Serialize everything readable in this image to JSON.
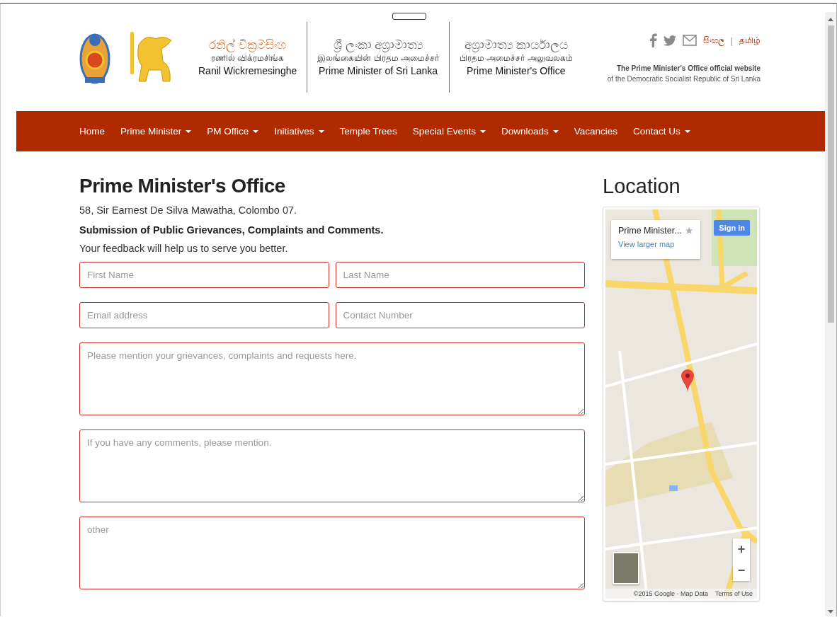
{
  "header": {
    "brands": [
      {
        "lines": [
          "රනිල් වික්‍රමසිංහ",
          "ரணில் விக்ரமசிங்க",
          "Ranil Wickremesinghe"
        ]
      },
      {
        "lines": [
          "ශ්‍රී ලංකා අග්‍රාමාත්‍ය",
          "இலங்கையின் பிரதம அமைச்சர்",
          "Prime Minister of Sri Lanka"
        ]
      },
      {
        "lines": [
          "අග්‍රාමාත්‍ය කාර්යාලය",
          "பிரதம அமைச்சர் அலுவலகம்",
          "Prime Minister's Office"
        ]
      }
    ],
    "languages": [
      "සිංහල",
      "தமிழ்"
    ],
    "language_separator": "|",
    "tagline": "The Prime Minister's Office official website",
    "subtagline": "of the Democratic Socialist Republic of Sri Lanka"
  },
  "nav": {
    "items": [
      {
        "label": "Home",
        "has_menu": false
      },
      {
        "label": "Prime Minister",
        "has_menu": true
      },
      {
        "label": "PM Office",
        "has_menu": true
      },
      {
        "label": "Initiatives",
        "has_menu": true
      },
      {
        "label": "Temple Trees",
        "has_menu": false
      },
      {
        "label": "Special Events",
        "has_menu": true
      },
      {
        "label": "Downloads",
        "has_menu": true
      },
      {
        "label": "Vacancies",
        "has_menu": false
      },
      {
        "label": "Contact Us",
        "has_menu": true
      }
    ]
  },
  "content": {
    "title": "Prime Minister's Office",
    "address": "58, Sir Earnest De Silva Mawatha, Colombo 07.",
    "heading": "Submission of Public Grievances, Complaints and Comments.",
    "intro": "Your feedback will help us to serve you better.",
    "fields": [
      {
        "kind": "input",
        "placeholder": "First Name"
      },
      {
        "kind": "input",
        "placeholder": "Last Name"
      },
      {
        "kind": "input",
        "placeholder": "Email address"
      },
      {
        "kind": "input",
        "placeholder": "Contact Number"
      },
      {
        "kind": "textarea",
        "placeholder": "Please mention your grievances, complaints and requests here."
      },
      {
        "kind": "textarea",
        "placeholder": "If you have any comments, please mention."
      },
      {
        "kind": "textarea",
        "placeholder": "other"
      }
    ]
  },
  "sidebar": {
    "title": "Location",
    "map": {
      "place": "Prime Minister...",
      "link": "View larger map",
      "sign_in": "Sign in",
      "zoom_in": "+",
      "zoom_out": "−",
      "attribution": "©2015 Google - Map Data",
      "terms": "Terms of Use"
    }
  }
}
